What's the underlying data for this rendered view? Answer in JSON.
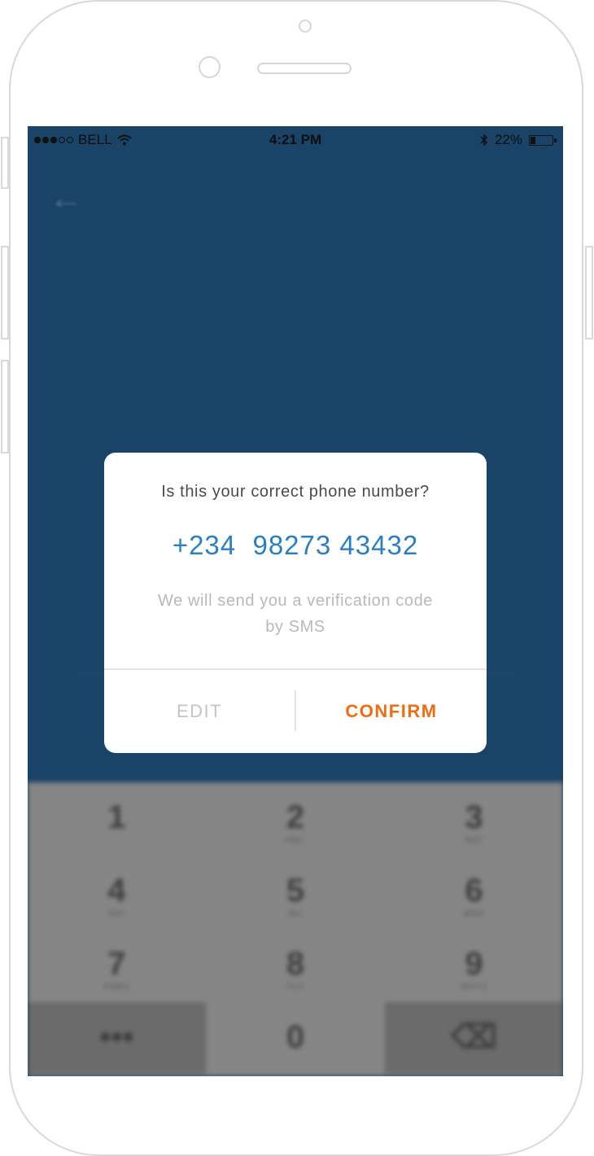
{
  "status_bar": {
    "carrier": "BELL",
    "time": "4:21 PM",
    "battery": "22%",
    "battery_level": 0.22,
    "signal_filled": 3,
    "signal_total": 5
  },
  "header": {
    "back_icon": "arrow-left-icon"
  },
  "dialog": {
    "question": "Is this your correct phone number?",
    "phone": "+234  98273 43432",
    "note": "We will send you a verification code by SMS",
    "edit_label": "EDIT",
    "confirm_label": "CONFIRM"
  },
  "keypad": {
    "keys": [
      {
        "num": "1",
        "letters": ""
      },
      {
        "num": "2",
        "letters": "ABC"
      },
      {
        "num": "3",
        "letters": "DEF"
      },
      {
        "num": "4",
        "letters": "GHI"
      },
      {
        "num": "5",
        "letters": "JKL"
      },
      {
        "num": "6",
        "letters": "MNO"
      },
      {
        "num": "7",
        "letters": "PQRS"
      },
      {
        "num": "8",
        "letters": "TUV"
      },
      {
        "num": "9",
        "letters": "WXYZ"
      },
      {
        "num": "•••",
        "letters": ""
      },
      {
        "num": "0",
        "letters": ""
      },
      {
        "num": "⌫",
        "letters": ""
      }
    ]
  },
  "colors": {
    "background": "#194367",
    "phone_number": "#2a7fc3",
    "confirm": "#ef6c11",
    "edit": "#c4c4c4"
  }
}
